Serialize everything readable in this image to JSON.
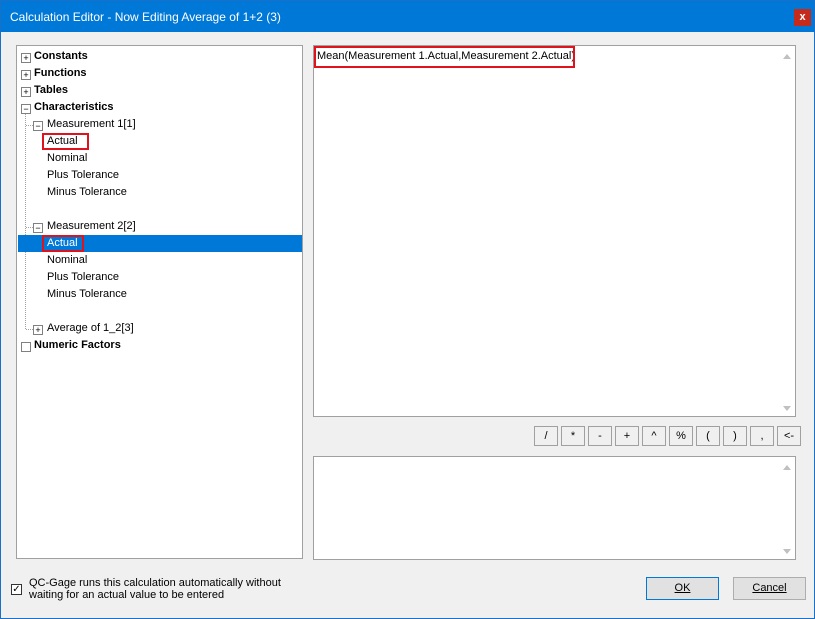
{
  "window": {
    "title": "Calculation Editor - Now Editing Average of 1+2 (3)",
    "close_label": "x"
  },
  "tree": {
    "constants": "Constants",
    "functions": "Functions",
    "tables": "Tables",
    "characteristics": "Characteristics",
    "measurement1": {
      "label": "Measurement 1[1]",
      "children": [
        "Actual",
        "Nominal",
        "Plus Tolerance",
        "Minus Tolerance"
      ]
    },
    "measurement2": {
      "label": "Measurement 2[2]",
      "children": [
        "Actual",
        "Nominal",
        "Plus Tolerance",
        "Minus Tolerance"
      ]
    },
    "average": "Average of 1_2[3]",
    "numeric_factors": "Numeric Factors",
    "plus_glyph": "+",
    "minus_glyph": "−"
  },
  "formula": {
    "text": "Mean(Measurement 1.Actual,Measurement 2.Actual)"
  },
  "operators": [
    "/",
    "*",
    "-",
    "+",
    "^",
    "%",
    "(",
    ")",
    ",",
    "<-"
  ],
  "notes": {
    "text": ""
  },
  "auto_calc": {
    "checked": true,
    "check_glyph": "✓",
    "label": "QC-Gage runs this calculation automatically without waiting for an actual value to be entered"
  },
  "buttons": {
    "ok": "OK",
    "cancel": "Cancel"
  },
  "colors": {
    "title_bar": "#0078d7",
    "selection": "#0078d7",
    "highlight_box": "#e0121c",
    "close_button": "#c42b1c"
  }
}
